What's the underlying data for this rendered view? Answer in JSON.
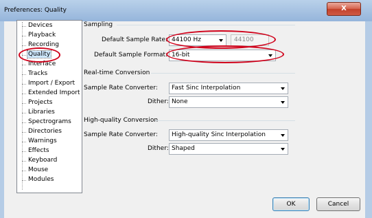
{
  "window": {
    "title": "Preferences: Quality",
    "close_label": "X"
  },
  "sidebar": {
    "items": [
      {
        "label": "Devices"
      },
      {
        "label": "Playback"
      },
      {
        "label": "Recording"
      },
      {
        "label": "Quality",
        "selected": true
      },
      {
        "label": "Interface"
      },
      {
        "label": "Tracks"
      },
      {
        "label": "Import / Export"
      },
      {
        "label": "Extended Import"
      },
      {
        "label": "Projects"
      },
      {
        "label": "Libraries"
      },
      {
        "label": "Spectrograms"
      },
      {
        "label": "Directories"
      },
      {
        "label": "Warnings"
      },
      {
        "label": "Effects"
      },
      {
        "label": "Keyboard"
      },
      {
        "label": "Mouse"
      },
      {
        "label": "Modules"
      }
    ]
  },
  "sampling": {
    "title": "Sampling",
    "rate_label": "Default Sample Rate:",
    "rate_value": "44100 Hz",
    "rate_custom_value": "44100",
    "format_label": "Default Sample Format:",
    "format_value": "16-bit"
  },
  "realtime": {
    "title": "Real-time Conversion",
    "converter_label": "Sample Rate Converter:",
    "converter_value": "Fast Sinc Interpolation",
    "dither_label": "Dither:",
    "dither_value": "None"
  },
  "highquality": {
    "title": "High-quality Conversion",
    "converter_label": "Sample Rate Converter:",
    "converter_value": "High-quality Sinc Interpolation",
    "dither_label": "Dither:",
    "dither_value": "Shaped"
  },
  "buttons": {
    "ok": "OK",
    "cancel": "Cancel"
  },
  "colors": {
    "highlight_annotation": "#d0021b",
    "selection": "#cde8ff"
  }
}
